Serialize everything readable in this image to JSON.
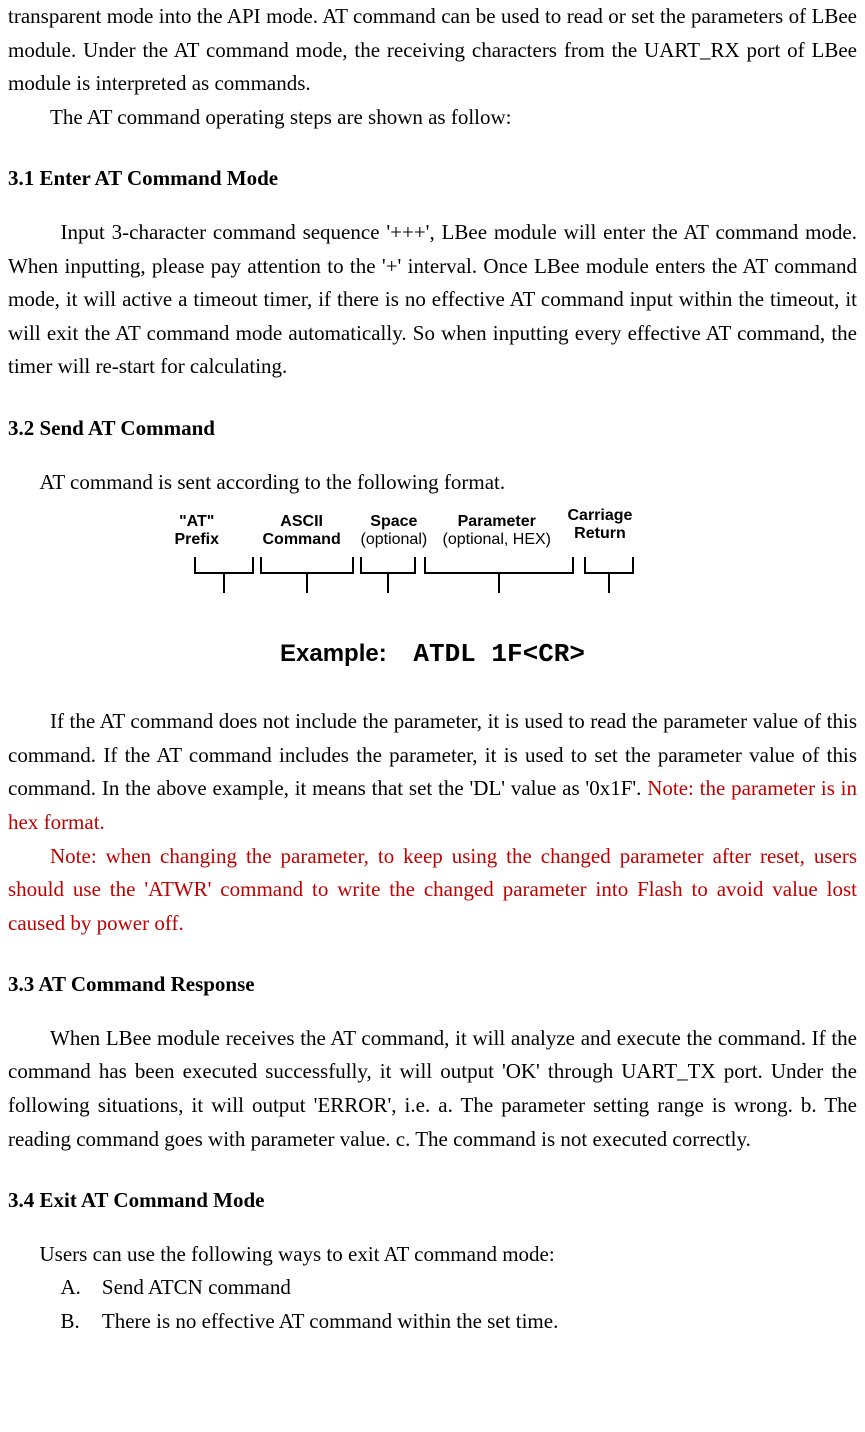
{
  "intro": {
    "p1": "transparent mode into the API mode. AT command can be used to read or set the parameters of LBee module. Under the AT command mode, the receiving characters from the UART_RX port of LBee module is interpreted as commands.",
    "p2": "The AT command operating steps are shown as follow:"
  },
  "s31": {
    "title": "3.1 Enter AT Command Mode",
    "p1": "Input 3-character command sequence '+++', LBee module will enter the AT command mode. When inputting, please pay attention to the '+' interval. Once LBee module enters the AT command mode, it will active a timeout timer, if there is no effective AT command input within the timeout, it will exit the AT command mode automatically. So when inputting every effective AT command, the timer will re-start for calculating."
  },
  "s32": {
    "title": "3.2 Send AT Command",
    "intro": "AT command is sent according to the following format.",
    "fig": {
      "labels": {
        "l1a": "\"AT\"",
        "l1b": "Prefix",
        "l2a": "ASCII",
        "l2b": "Command",
        "l3a": "Space",
        "l3b": "(optional)",
        "l4a": "Parameter",
        "l4b": "(optional, HEX)",
        "l5a": "Carriage",
        "l5b": "Return"
      },
      "example_label": "Example:",
      "example_cmd": "ATDL 1F<CR>"
    },
    "p2a": "If the AT command does not include the parameter, it is used to read the parameter value of this command. If the AT command includes the parameter, it is used to set the parameter value of this command. In the above example, it means that set the 'DL' value as '0x1F'. ",
    "p2b": "Note: the parameter is in hex format.",
    "p3": "Note: when changing the parameter, to keep using the changed parameter after reset, users should use the 'ATWR' command to write the changed parameter into Flash to avoid value lost caused by power off."
  },
  "s33": {
    "title": "3.3 AT Command Response",
    "p1": "When LBee module receives the AT command, it will analyze and execute the command. If the command has been executed successfully, it will output 'OK' through UART_TX port. Under the following situations, it will output 'ERROR', i.e. a. The parameter setting range is wrong. b. The reading command goes with parameter value. c. The command is not executed correctly."
  },
  "s34": {
    "title": "3.4 Exit AT Command Mode",
    "intro": "Users can use the following ways to exit AT command mode:",
    "items": {
      "a_letter": "A.",
      "a_text": "Send ATCN command",
      "b_letter": "B.",
      "b_text": "There is no effective AT command within the set time."
    }
  }
}
